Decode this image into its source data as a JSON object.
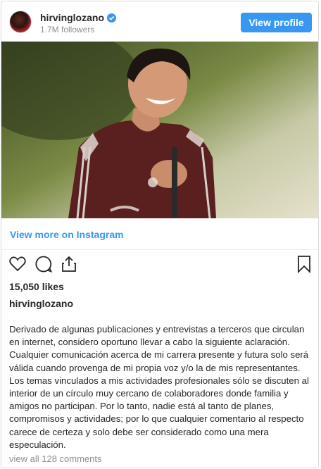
{
  "header": {
    "username": "hirvinglozano",
    "followers": "1.7M followers",
    "view_profile_label": "View profile"
  },
  "post": {
    "view_more_label": "View more on Instagram",
    "likes": "15,050 likes",
    "caption_user": "hirvinglozano",
    "caption": "Derivado de algunas publicaciones y entrevistas a terceros que circulan en internet, considero oportuno llevar a cabo la siguiente aclaración. Cualquier comunicación acerca de mi carrera presente y futura solo será válida cuando provenga de mi propia voz y/o la de mis representantes. Los temas vinculados a mis actividades profesionales sólo se discuten al interior de un círculo muy cercano de colaboradores donde familia y amigos no participan. Por lo tanto, nadie está al tanto de planes, compromisos y actividades; por lo que cualquier comentario al respecto carece de certeza y solo debe ser considerado como una mera especulación.",
    "view_comments": "view all 128 comments"
  },
  "icons": {
    "verified": "verified-badge-icon",
    "like": "heart-icon",
    "comment": "comment-bubble-icon",
    "share": "share-icon",
    "save": "bookmark-icon"
  },
  "colors": {
    "accent": "#3897f0",
    "text": "#262626",
    "muted": "#8e8e8e",
    "border": "#dbdbdb"
  }
}
